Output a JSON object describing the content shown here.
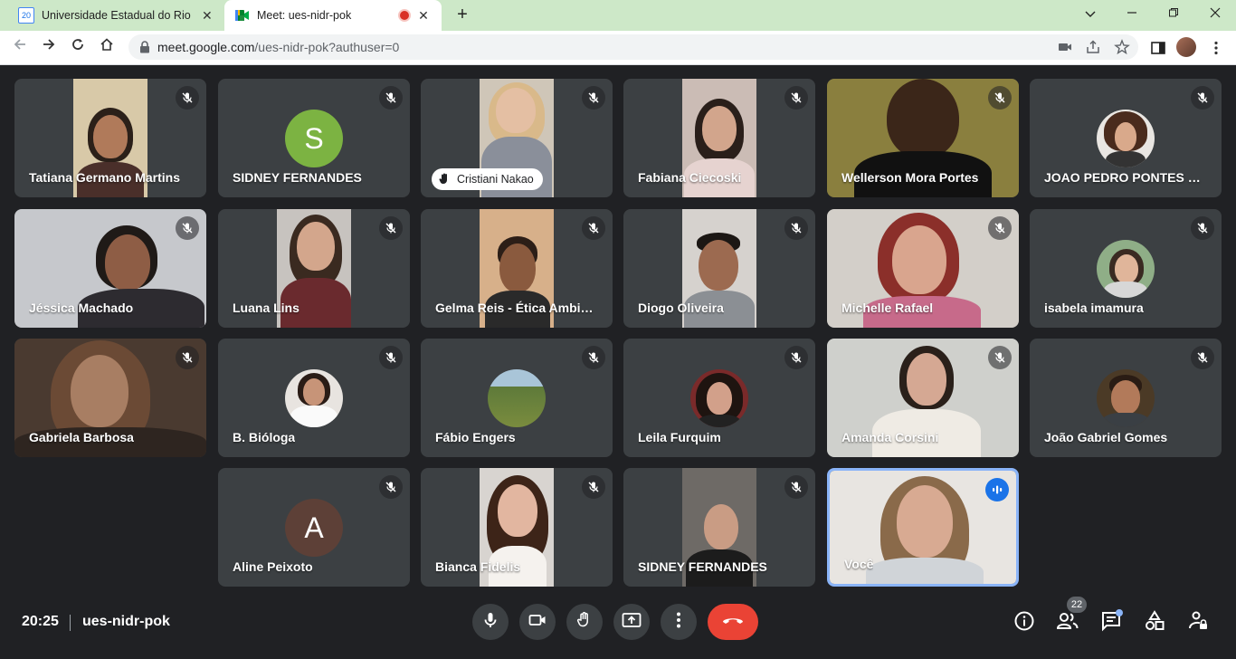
{
  "browser": {
    "tabs": [
      {
        "title": "Universidade Estadual do Rio Gra",
        "favicon_label": "20",
        "close_icon": "close-icon"
      },
      {
        "title": "Meet: ues-nidr-pok",
        "close_icon": "close-icon",
        "recording": true
      }
    ],
    "new_tab_label": "+",
    "url": {
      "host": "meet.google.com",
      "path": "/ues-nidr-pok?authuser=0"
    },
    "window_controls": [
      "chevron-down-icon",
      "minimize-icon",
      "restore-icon",
      "close-icon"
    ]
  },
  "meeting": {
    "time": "20:25",
    "code": "ues-nidr-pok",
    "participant_count": "22",
    "participants": [
      {
        "name": "Tatiana Germano Martins",
        "muted": true,
        "kind": "video"
      },
      {
        "name": "SIDNEY FERNANDES",
        "muted": true,
        "kind": "letter",
        "initial": "S",
        "color": "#7cb342"
      },
      {
        "name": "Cristiani Nakao",
        "muted": true,
        "kind": "video",
        "raised_hand": true
      },
      {
        "name": "Fabiana Ciecoski",
        "muted": true,
        "kind": "video"
      },
      {
        "name": "Wellerson Mora Portes",
        "muted": true,
        "kind": "video"
      },
      {
        "name": "JOAO PEDRO PONTES D...",
        "muted": true,
        "kind": "avatar"
      },
      {
        "name": "Jéssica Machado",
        "muted": true,
        "kind": "video"
      },
      {
        "name": "Luana Lins",
        "muted": true,
        "kind": "video"
      },
      {
        "name": "Gelma Reis - Ética Ambie...",
        "muted": true,
        "kind": "video"
      },
      {
        "name": "Diogo Oliveira",
        "muted": true,
        "kind": "video"
      },
      {
        "name": "Michelle Rafael",
        "muted": true,
        "kind": "video"
      },
      {
        "name": "isabela imamura",
        "muted": true,
        "kind": "avatar"
      },
      {
        "name": "Gabriela Barbosa",
        "muted": true,
        "kind": "video"
      },
      {
        "name": "B. Bióloga",
        "muted": true,
        "kind": "avatar"
      },
      {
        "name": "Fábio Engers",
        "muted": true,
        "kind": "avatar"
      },
      {
        "name": "Leila Furquim",
        "muted": true,
        "kind": "avatar"
      },
      {
        "name": "Amanda Corsini",
        "muted": true,
        "kind": "video"
      },
      {
        "name": "João Gabriel Gomes",
        "muted": true,
        "kind": "avatar"
      },
      {
        "name": "Aline Peixoto",
        "muted": true,
        "kind": "letter",
        "initial": "A",
        "color": "#5d4037"
      },
      {
        "name": "Bianca Fidelis",
        "muted": true,
        "kind": "video"
      },
      {
        "name": "SIDNEY FERNANDES",
        "muted": true,
        "kind": "video"
      },
      {
        "name": "Você",
        "muted": false,
        "kind": "video",
        "speaking": true
      }
    ]
  },
  "controls": [
    "mic-icon",
    "camera-icon",
    "raise-hand-icon",
    "present-icon",
    "more-options-icon",
    "leave-call-icon"
  ],
  "side_controls": [
    "info-icon",
    "people-icon",
    "chat-icon",
    "activities-icon",
    "host-controls-icon"
  ],
  "colors": {
    "tab_strip": "#cde8c8",
    "meet_bg": "#202124",
    "tile_bg": "#3c4043",
    "leave": "#ea4335",
    "speaking": "#1a73e8"
  }
}
